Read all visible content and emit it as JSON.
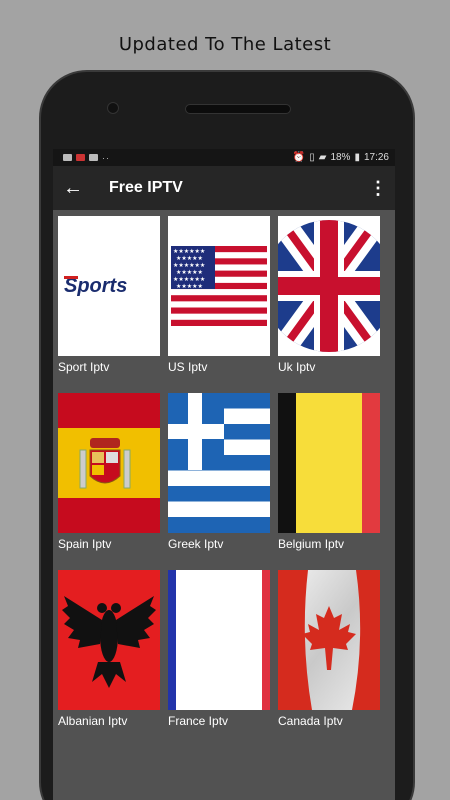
{
  "headline": "Updated To The Latest",
  "status": {
    "battery": "18%",
    "time": "17:26",
    "notif_dots": "··"
  },
  "appbar": {
    "title": "Free IPTV"
  },
  "channels": [
    {
      "label": "Sport Iptv",
      "logo_text": "Sports"
    },
    {
      "label": "US Iptv"
    },
    {
      "label": "Uk Iptv"
    },
    {
      "label": "Spain Iptv"
    },
    {
      "label": "Greek Iptv"
    },
    {
      "label": "Belgium Iptv"
    },
    {
      "label": "Albanian Iptv"
    },
    {
      "label": "France Iptv"
    },
    {
      "label": "Canada Iptv"
    }
  ],
  "colors": {
    "screen_bg": "#525252",
    "appbar_bg": "#262626",
    "statusbar_bg": "#151515"
  }
}
